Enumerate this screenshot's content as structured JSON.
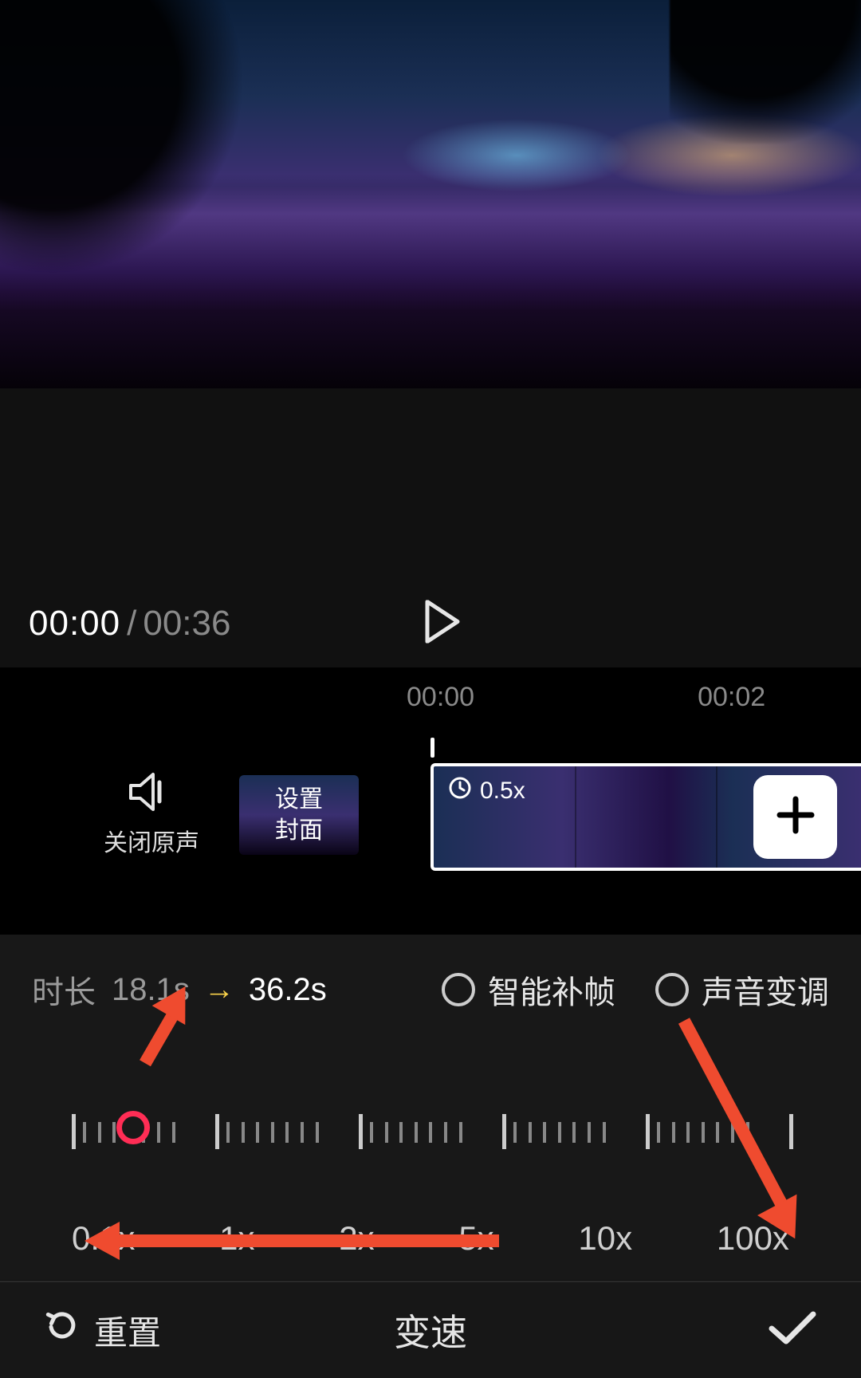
{
  "playback": {
    "current_time": "00:00",
    "separator": "/",
    "total_time": "00:36"
  },
  "timeline": {
    "ruler": {
      "label_a": "00:00",
      "label_b": "00:02"
    },
    "mute": {
      "label": "关闭原声"
    },
    "cover": {
      "label": "设置\n封面"
    },
    "clip": {
      "speed_badge": "0.5x"
    }
  },
  "speed": {
    "duration_label": "时长",
    "from": "18.1s",
    "arrow": "→",
    "to": "36.2s",
    "option_interpolate": "智能补帧",
    "option_pitch": "声音变调",
    "marks": [
      "0.1x",
      "1x",
      "2x",
      "5x",
      "10x",
      "100x"
    ],
    "handle_position_pct": 8.5
  },
  "bottom": {
    "reset": "重置",
    "title": "变速"
  }
}
